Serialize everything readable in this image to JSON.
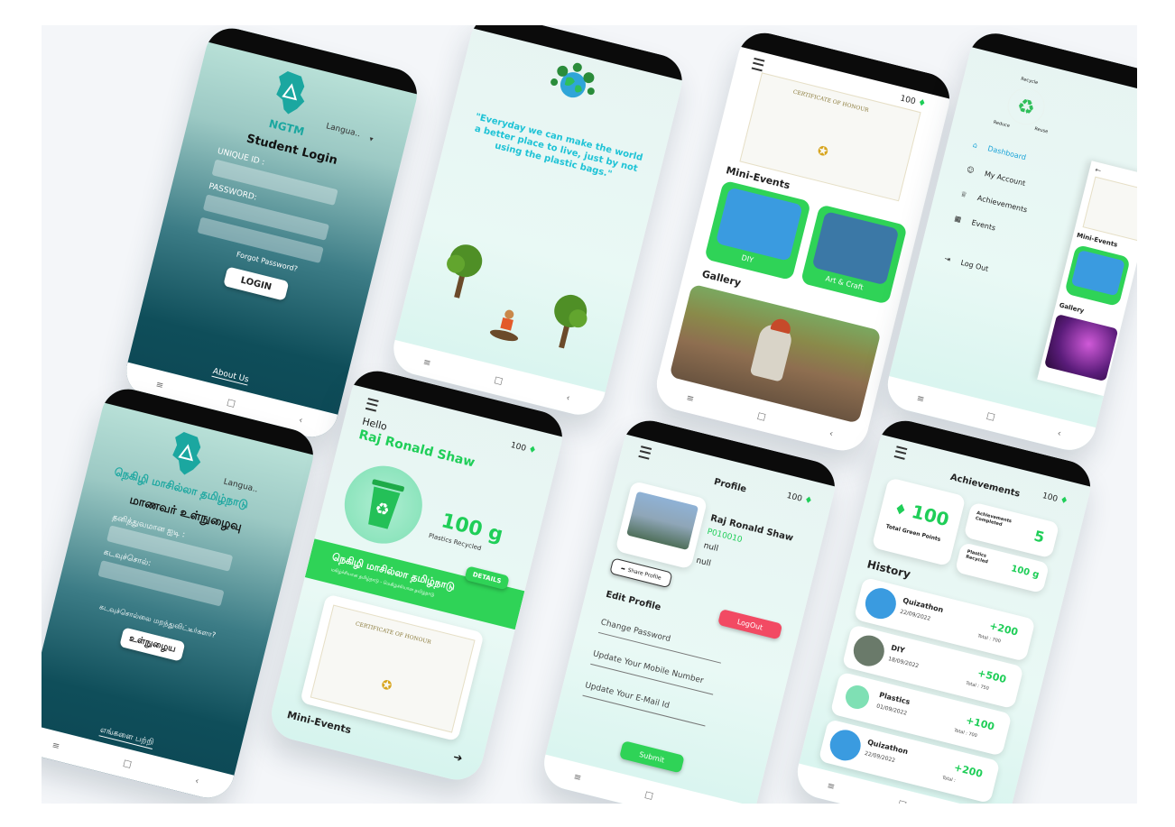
{
  "login_en": {
    "brand": "NGTM",
    "language": "Langua..",
    "title": "Student Login",
    "unique_id_label": "UNIQUE ID :",
    "password_label": "PASSWORD:",
    "forgot": "Forgot Password?",
    "login_button": "LOGIN",
    "about": "About Us"
  },
  "login_ta": {
    "brand": "நெகிழி மாசில்லா தமிழ்நாடு",
    "language": "Langua..",
    "title": "மாணவர் உள்நுழைவு",
    "unique_id_label": "தனித்துவமான ஐடி :",
    "password_label": "கடவுச்சொல்:",
    "forgot": "கடவுச்சொல்லை மறந்துவிட்டீர்களா?",
    "login_button": "உள்நுழைய",
    "about": "எங்களை பற்றி"
  },
  "splash": {
    "quote": "\"Everyday we can make the world a better place to live, just by not using the plastic bags.\""
  },
  "home": {
    "hello": "Hello",
    "name": "Raj Ronald Shaw",
    "points": "100",
    "recycled_value": "100 g",
    "recycled_label": "Plastics Recycled",
    "banner_title": "நெகிழி மாசில்லா தமிழ்நாடு",
    "banner_sub": "மகிழ்ச்சியான தமிழ்நாடு - மெகிழ்ச்சியான தமிழ்நாடு",
    "details_button": "DETAILS",
    "mini_events": "Mini-Events",
    "cert_title": "CERTIFICATE OF HONOUR"
  },
  "events": {
    "points": "100",
    "cert_title": "CERTIFICATE OF HONOUR",
    "mini_events": "Mini-Events",
    "cards": [
      "DIY",
      "Art & Craft"
    ],
    "gallery": "Gallery"
  },
  "profile": {
    "title": "Profile",
    "points": "100",
    "name": "Raj Ronald Shaw",
    "id": "P010010",
    "null1": "null",
    "null2": "null",
    "share": "Share Profile",
    "logout": "LogOut",
    "edit": "Edit Profile",
    "options": [
      "Change Password",
      "Update Your Mobile Number",
      "Update Your E-Mail Id"
    ],
    "submit": "Submit"
  },
  "drawer": {
    "logo_words": [
      "Recycle",
      "Reduce",
      "Reuse"
    ],
    "items": [
      "Dashboard",
      "My Account",
      "Achievements",
      "Events"
    ],
    "logout": "Log Out",
    "peek_mini": "Mini-Events",
    "peek_gallery": "Gallery"
  },
  "achievements": {
    "title": "Achievements",
    "points": "100",
    "green_points": "100",
    "green_points_label": "Total Green Points",
    "completed_label": "Achievements Completed",
    "completed_value": "5",
    "recycled_label": "Plastics Recycled",
    "recycled_value": "100 g",
    "history_title": "History",
    "history": [
      {
        "name": "Quizathon",
        "date": "22/09/2022",
        "delta": "+200",
        "total": "Total :  700"
      },
      {
        "name": "DIY",
        "date": "18/09/2022",
        "delta": "+500",
        "total": "Total :  750"
      },
      {
        "name": "Plastics",
        "date": "01/09/2022",
        "delta": "+100",
        "total": "Total :  700"
      },
      {
        "name": "Quizathon",
        "date": "22/09/2022",
        "delta": "+200",
        "total": "Total :"
      }
    ]
  },
  "colors": {
    "accent": "#1fce58",
    "teal": "#1ba7a0",
    "logout": "#f24a63"
  }
}
